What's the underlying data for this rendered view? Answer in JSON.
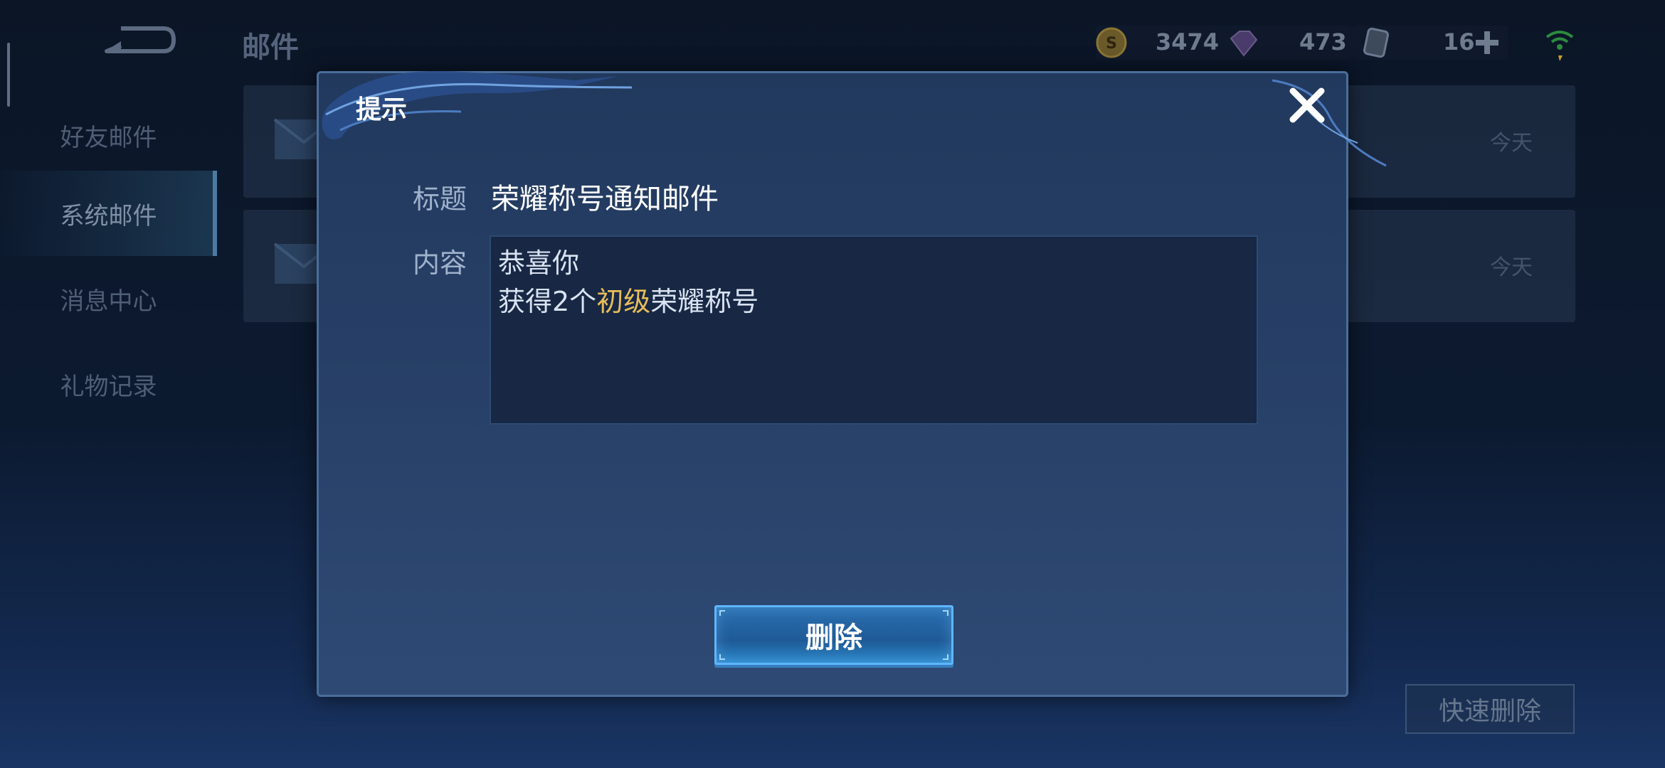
{
  "page": {
    "title": "邮件",
    "back_icon": "back-arrow-icon"
  },
  "currency": {
    "gold": "3474",
    "diamonds": "473",
    "vouchers": "16",
    "add_icon": "plus-icon",
    "wifi_icon": "wifi-icon"
  },
  "sidebar": {
    "items": [
      {
        "label": "好友邮件",
        "active": false
      },
      {
        "label": "系统邮件",
        "active": true
      },
      {
        "label": "消息中心",
        "active": false
      },
      {
        "label": "礼物记录",
        "active": false
      }
    ]
  },
  "mail_list": [
    {
      "date": "今天"
    },
    {
      "date": "今天"
    }
  ],
  "quick_delete_label": "快速删除",
  "dialog": {
    "title": "提示",
    "close_icon": "close-icon",
    "subject_label": "标题",
    "subject_value": "荣耀称号通知邮件",
    "content_label": "内容",
    "content_line1": "恭喜你",
    "content_line2_prefix": "获得2个",
    "content_line2_highlight": "初级",
    "content_line2_suffix": "荣耀称号",
    "delete_label": "删除"
  },
  "colors": {
    "highlight": "#e8bd5a",
    "button_blue": "#2a6fb0",
    "modal_bg": "#273f66"
  }
}
